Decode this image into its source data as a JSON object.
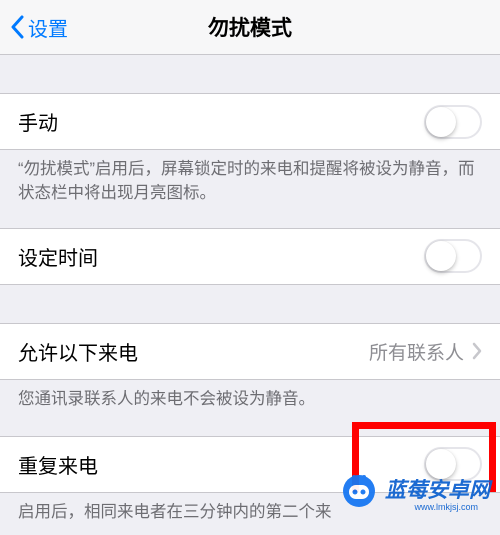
{
  "nav": {
    "back_label": "设置",
    "title": "勿扰模式"
  },
  "group1": {
    "manual_label": "手动",
    "footer": "“勿扰模式”启用后，屏幕锁定时的来电和提醒将被设为静音，而状态栏中将出现月亮图标。"
  },
  "group2": {
    "schedule_label": "设定时间"
  },
  "group3": {
    "allow_calls_label": "允许以下来电",
    "allow_calls_value": "所有联系人",
    "footer": "您通讯录联系人的来电不会被设为静音。"
  },
  "group4": {
    "repeated_calls_label": "重复来电",
    "footer_partial": "启用后，相同来电者在三分钟内的第二个来"
  },
  "watermark": {
    "text": "蓝莓安卓网",
    "url": "www.lmkjsj.com"
  },
  "colors": {
    "accent": "#007aff",
    "highlight": "#ff0000",
    "brand": "#1063d0"
  }
}
